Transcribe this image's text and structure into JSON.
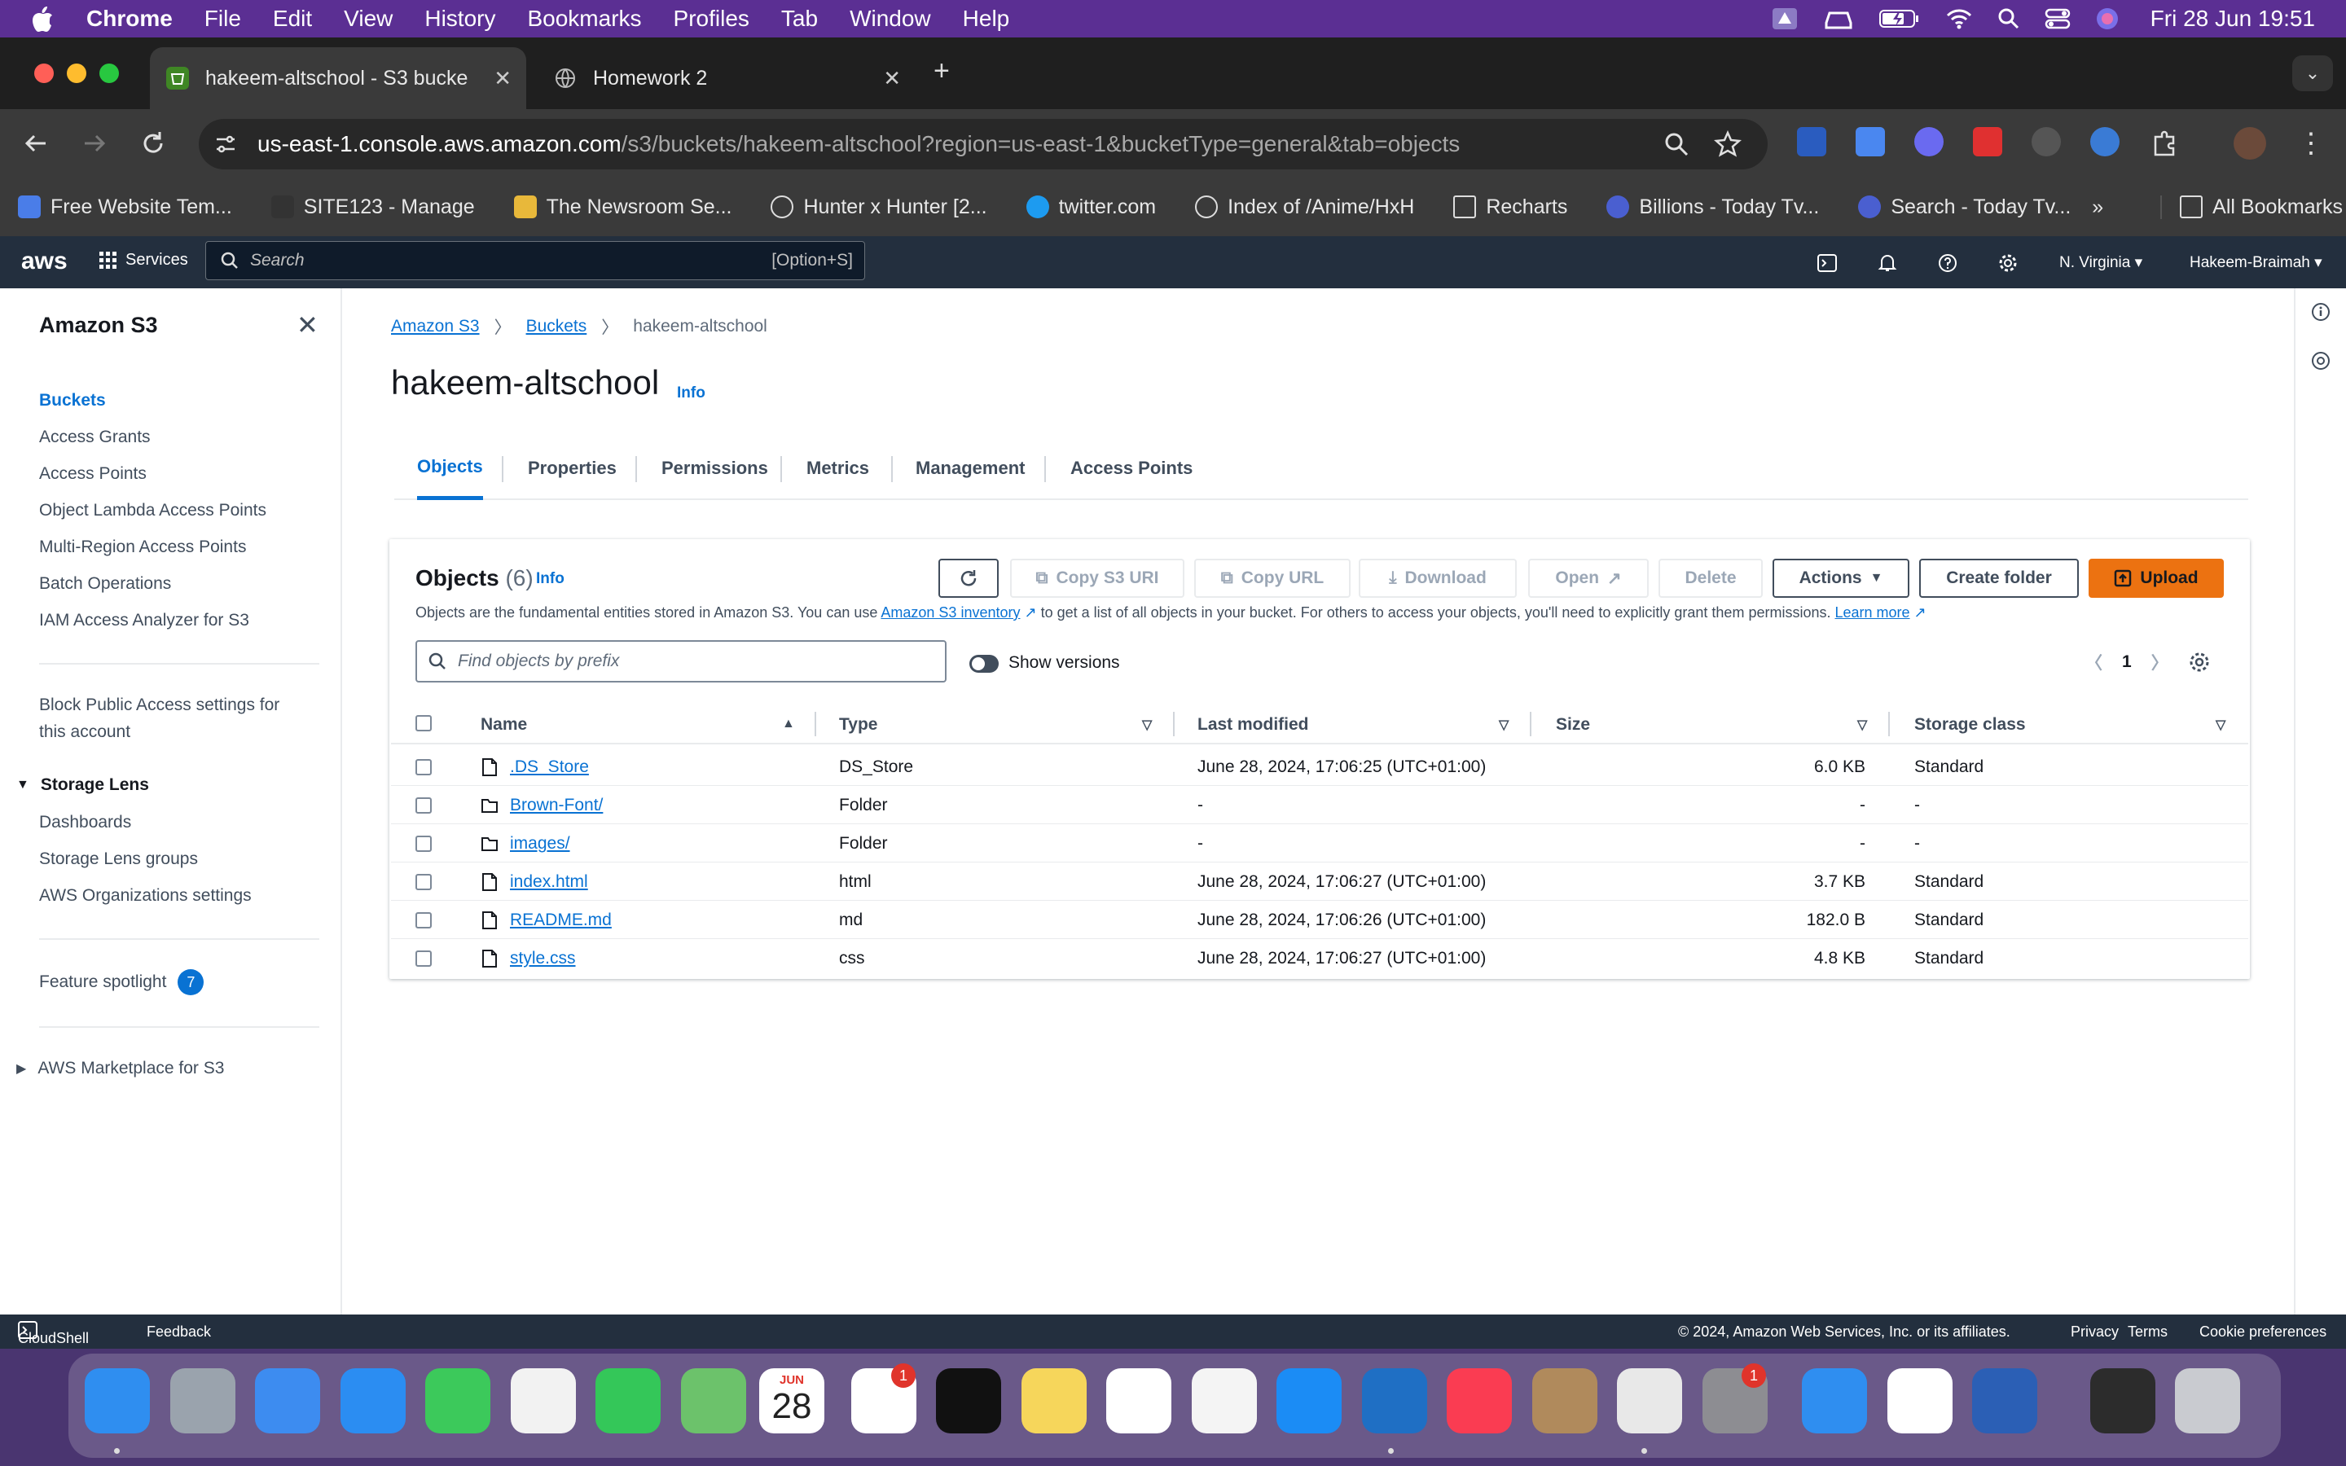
{
  "menubar": {
    "app": "Chrome",
    "items": [
      "File",
      "Edit",
      "View",
      "History",
      "Bookmarks",
      "Profiles",
      "Tab",
      "Window",
      "Help"
    ],
    "clock": "Fri 28 Jun  19:51"
  },
  "browser": {
    "tabs": [
      {
        "title": "hakeem-altschool - S3 bucke",
        "active": true
      },
      {
        "title": "Homework 2",
        "active": false
      }
    ],
    "url_host": "us-east-1.console.aws.amazon.com",
    "url_path": "/s3/buckets/hakeem-altschool?region=us-east-1&bucketType=general&tab=objects",
    "bookmarks": [
      {
        "label": "Free Website Tem...",
        "color": "#4a7de8"
      },
      {
        "label": "SITE123 - Manage",
        "color": "#333333"
      },
      {
        "label": "The Newsroom Se...",
        "color": "#e8b83a"
      },
      {
        "label": "Hunter x Hunter [2...",
        "color": "#dddddd"
      },
      {
        "label": "twitter.com",
        "color": "#1d9bf0"
      },
      {
        "label": "Index of /Anime/HxH",
        "color": "#dddddd"
      },
      {
        "label": "Recharts",
        "color": "#888888"
      },
      {
        "label": "Billions - Today Tv...",
        "color": "#4a5fd0"
      },
      {
        "label": "Search - Today Tv...",
        "color": "#4a5fd0"
      }
    ],
    "all_bookmarks": "All Bookmarks"
  },
  "aws": {
    "logo": "aws",
    "services": "Services",
    "search_placeholder": "Search",
    "search_shortcut": "[Option+S]",
    "region": "N. Virginia",
    "account": "Hakeem-Braimah"
  },
  "sidebar": {
    "title": "Amazon S3",
    "items": [
      "Buckets",
      "Access Grants",
      "Access Points",
      "Object Lambda Access Points",
      "Multi-Region Access Points",
      "Batch Operations",
      "IAM Access Analyzer for S3"
    ],
    "block_public_1": "Block Public Access settings for",
    "block_public_2": "this account",
    "storage_lens": "Storage Lens",
    "storage_lens_items": [
      "Dashboards",
      "Storage Lens groups",
      "AWS Organizations settings"
    ],
    "feature_spotlight": "Feature spotlight",
    "feature_count": "7",
    "marketplace": "AWS Marketplace for S3"
  },
  "breadcrumb": [
    "Amazon S3",
    "Buckets",
    "hakeem-altschool"
  ],
  "page": {
    "title": "hakeem-altschool",
    "info": "Info",
    "tabs": [
      "Objects",
      "Properties",
      "Permissions",
      "Metrics",
      "Management",
      "Access Points"
    ]
  },
  "objects": {
    "title": "Objects",
    "count": "(6)",
    "info": "Info",
    "desc_1": "Objects are the fundamental entities stored in Amazon S3. You can use",
    "desc_link": "Amazon S3 inventory",
    "desc_2": "to get a list of all objects in your bucket. For others to access your objects, you'll need to explicitly grant them permissions.",
    "learn_more": "Learn more",
    "buttons": {
      "copy_uri": "Copy S3 URI",
      "copy_url": "Copy URL",
      "download": "Download",
      "open": "Open",
      "delete": "Delete",
      "actions": "Actions",
      "create_folder": "Create folder",
      "upload": "Upload"
    },
    "search_placeholder": "Find objects by prefix",
    "show_versions": "Show versions",
    "page": "1",
    "columns": [
      "Name",
      "Type",
      "Last modified",
      "Size",
      "Storage class"
    ],
    "rows": [
      {
        "name": ".DS_Store",
        "type": "DS_Store",
        "modified": "June 28, 2024, 17:06:25 (UTC+01:00)",
        "size": "6.0 KB",
        "class": "Standard",
        "icon": "file-icon"
      },
      {
        "name": "Brown-Font/",
        "type": "Folder",
        "modified": "-",
        "size": "-",
        "class": "-",
        "icon": "folder-icon"
      },
      {
        "name": "images/",
        "type": "Folder",
        "modified": "-",
        "size": "-",
        "class": "-",
        "icon": "folder-icon"
      },
      {
        "name": "index.html",
        "type": "html",
        "modified": "June 28, 2024, 17:06:27 (UTC+01:00)",
        "size": "3.7 KB",
        "class": "Standard",
        "icon": "file-icon"
      },
      {
        "name": "README.md",
        "type": "md",
        "modified": "June 28, 2024, 17:06:26 (UTC+01:00)",
        "size": "182.0 B",
        "class": "Standard",
        "icon": "file-icon"
      },
      {
        "name": "style.css",
        "type": "css",
        "modified": "June 28, 2024, 17:06:27 (UTC+01:00)",
        "size": "4.8 KB",
        "class": "Standard",
        "icon": "file-icon"
      }
    ]
  },
  "footer": {
    "cloudshell": "CloudShell",
    "feedback": "Feedback",
    "copyright": "© 2024, Amazon Web Services, Inc. or its affiliates.",
    "privacy": "Privacy",
    "terms": "Terms",
    "cookies": "Cookie preferences"
  },
  "dock": {
    "calendar_month": "JUN",
    "calendar_day": "28",
    "reminders_badge": "1",
    "settings_badge": "1",
    "apps": [
      {
        "name": "finder-icon",
        "color": "#2f8ef0"
      },
      {
        "name": "launchpad-icon",
        "color": "#9aa3ad"
      },
      {
        "name": "mail-icon",
        "color": "#3d8cf0"
      },
      {
        "name": "safari-icon",
        "color": "#2b8df2"
      },
      {
        "name": "messages-icon",
        "color": "#3cc95b"
      },
      {
        "name": "photos-icon",
        "color": "#f2f2f2"
      },
      {
        "name": "facetime-icon",
        "color": "#34c759"
      },
      {
        "name": "maps-icon",
        "color": "#6cc26b"
      },
      {
        "name": "calendar-icon",
        "color": "#ffffff"
      },
      {
        "name": "reminders-icon",
        "color": "#ffffff"
      },
      {
        "name": "tv-icon",
        "color": "#111111"
      },
      {
        "name": "notes-icon",
        "color": "#f6d65b"
      },
      {
        "name": "freeform-icon",
        "color": "#ffffff"
      },
      {
        "name": "news-icon",
        "color": "#f4f4f4"
      },
      {
        "name": "app-store-icon",
        "color": "#1b8cf5"
      },
      {
        "name": "vscode-icon",
        "color": "#1f6fc4"
      },
      {
        "name": "music-icon",
        "color": "#fa3c52"
      },
      {
        "name": "contacts-icon",
        "color": "#b08a5c"
      },
      {
        "name": "chrome-icon",
        "color": "#e8e8e8"
      },
      {
        "name": "system-settings-icon",
        "color": "#8d8d92"
      },
      {
        "name": "migration-icon",
        "color": "#2f8ef0"
      },
      {
        "name": "slack-icon",
        "color": "#ffffff"
      },
      {
        "name": "word-icon",
        "color": "#2b5fb5"
      },
      {
        "name": "screenshot-thumb-icon",
        "color": "#2c2c2c"
      },
      {
        "name": "trash-icon",
        "color": "#c9cbd0"
      }
    ]
  }
}
